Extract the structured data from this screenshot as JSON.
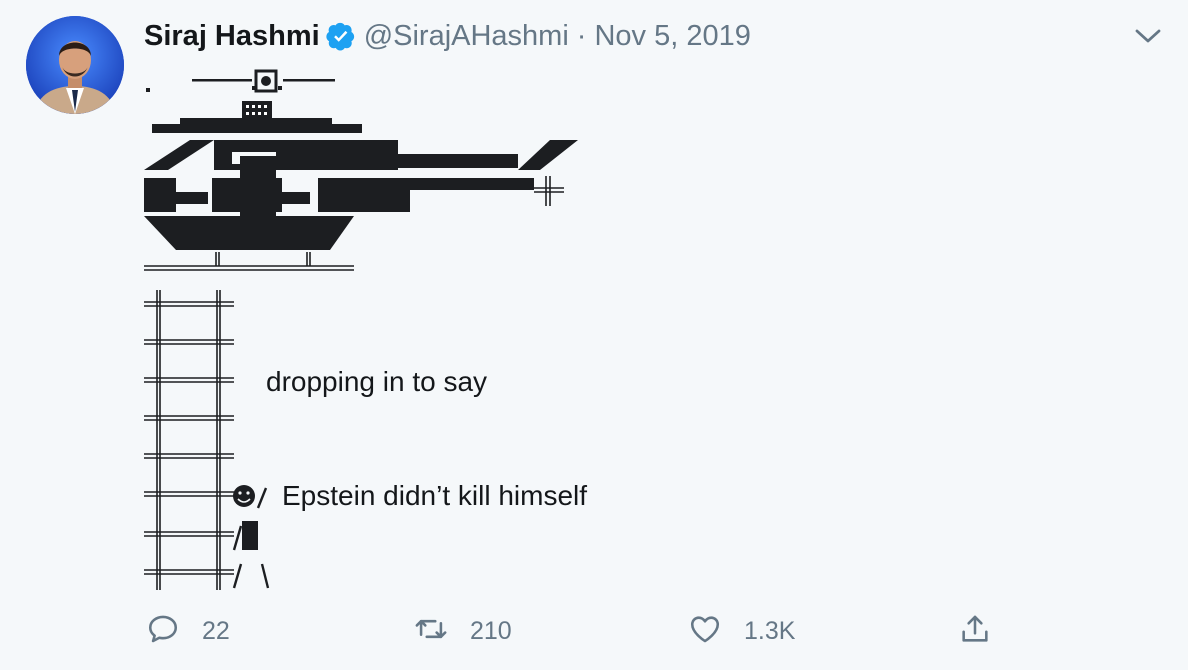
{
  "tweet": {
    "author_name": "Siraj Hashmi",
    "handle": "@SirajAHashmi",
    "separator": "·",
    "date": "Nov 5, 2019",
    "line_rope": "dropping in to say",
    "line_person": "Epstein didn’t kill himself"
  },
  "icons": {
    "verified": "verified-badge-icon",
    "caret": "chevron-down-icon",
    "reply": "reply-icon",
    "retweet": "retweet-icon",
    "like": "heart-icon",
    "share": "share-icon"
  },
  "actions": {
    "reply_count": "22",
    "retweet_count": "210",
    "like_count": "1.3K"
  },
  "colors": {
    "background": "#f5f8fa",
    "text": "#14171a",
    "secondary": "#657786",
    "verified": "#1da1f2",
    "art": "#1c1e21"
  }
}
